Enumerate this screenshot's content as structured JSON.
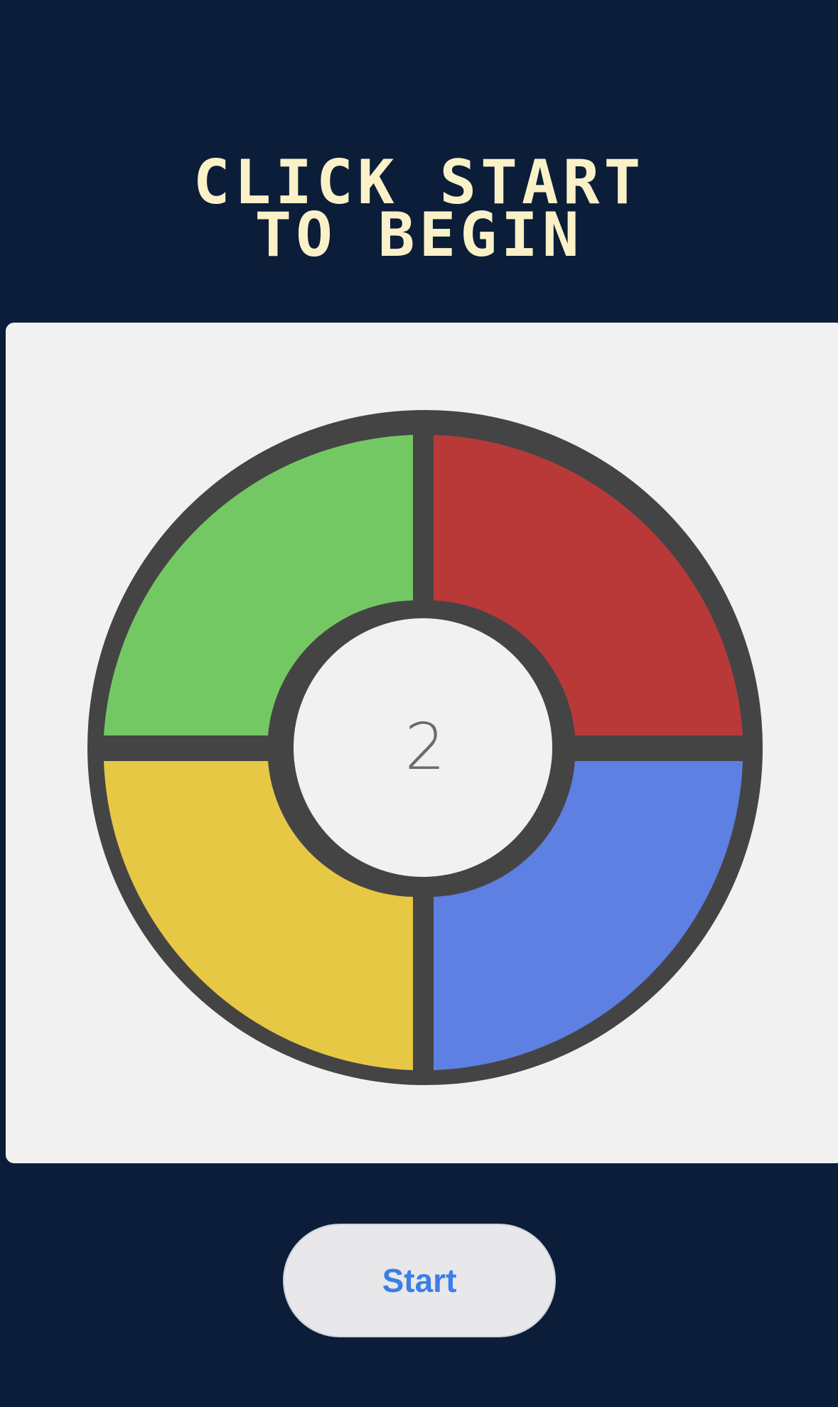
{
  "header": {
    "title_line1": "CLICK START",
    "title_line2": "TO BEGIN"
  },
  "game": {
    "counter": "2",
    "pads": [
      {
        "id": "green",
        "color": "#74c863"
      },
      {
        "id": "red",
        "color": "#b93939"
      },
      {
        "id": "yellow",
        "color": "#e6c845"
      },
      {
        "id": "blue",
        "color": "#5e80e3"
      }
    ],
    "outline_color": "#454445"
  },
  "controls": {
    "start_label": "Start"
  },
  "theme": {
    "background": "#0b1d39",
    "title_color": "#fbf1c8",
    "board_color": "#f1f1f1",
    "button_text_color": "#3c7ee8"
  }
}
